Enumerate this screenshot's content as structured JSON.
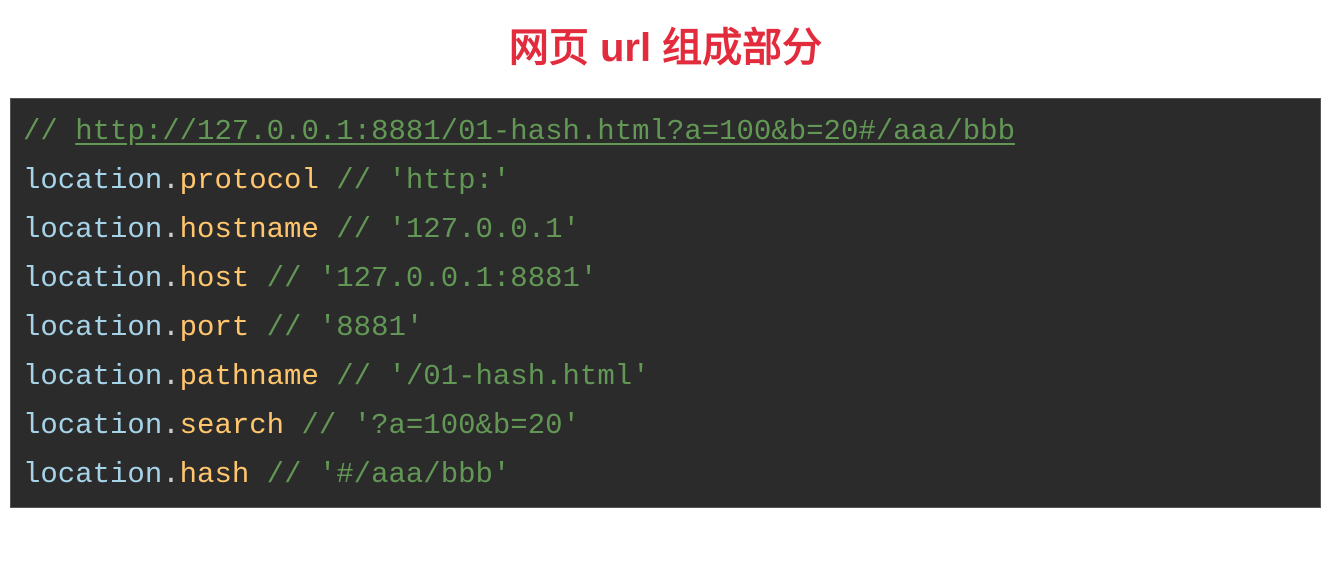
{
  "title": "网页 url 组成部分",
  "code": {
    "commentPrefix": "// ",
    "urlComment": "http://127.0.0.1:8881/01-hash.html?a=100&b=20#/aaa/bbb",
    "lines": [
      {
        "obj": "location",
        "prop": "protocol",
        "comment": " // 'http:'"
      },
      {
        "obj": "location",
        "prop": "hostname",
        "comment": " // '127.0.0.1'"
      },
      {
        "obj": "location",
        "prop": "host",
        "comment": " // '127.0.0.1:8881'"
      },
      {
        "obj": "location",
        "prop": "port",
        "comment": " // '8881'"
      },
      {
        "obj": "location",
        "prop": "pathname",
        "comment": " // '/01-hash.html'"
      },
      {
        "obj": "location",
        "prop": "search",
        "comment": " // '?a=100&b=20'"
      },
      {
        "obj": "location",
        "prop": "hash",
        "comment": " // '#/aaa/bbb'"
      }
    ]
  }
}
